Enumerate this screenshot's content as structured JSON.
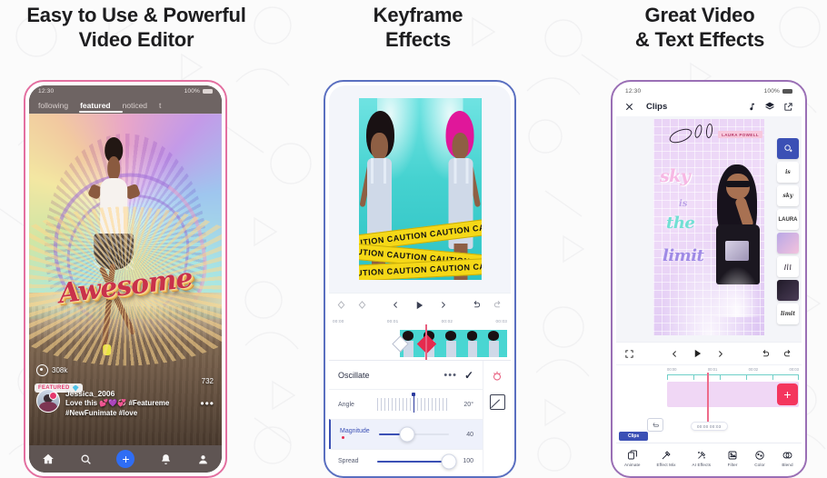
{
  "headings": {
    "left_line1": "Easy to Use & Powerful",
    "left_line2": "Video Editor",
    "mid_line1": "Keyframe",
    "mid_line2": "Effects",
    "right_line1": "Great Video",
    "right_line2": "& Text Effects"
  },
  "colors": {
    "frame_left": "#e36fa0",
    "frame_mid": "#5a6fc0",
    "frame_right": "#9a6fb5",
    "accent_blue": "#3b50b5",
    "accent_red": "#e52b4e",
    "fab_blue": "#2f6df4",
    "add_red": "#f4365e",
    "background": "#fbfbfb"
  },
  "phone1": {
    "status": {
      "time": "12:30",
      "battery": "100%"
    },
    "tabs": [
      {
        "label": "following",
        "active": false
      },
      {
        "label": "featured",
        "active": true
      },
      {
        "label": "noticed",
        "active": false
      },
      {
        "label": "t",
        "active": false
      }
    ],
    "artwork_text": "Awesome",
    "views": "308k",
    "likes": "732",
    "badge": "FEATURED",
    "username": "Jessica_2006",
    "caption_line1": "Love this 💕💜💞 #Featureme",
    "caption_line2": "#NewFunimate #love",
    "more_icon": "•••",
    "nav": [
      {
        "name": "home-icon",
        "label": "home"
      },
      {
        "name": "search-icon",
        "label": "search"
      },
      {
        "name": "create-icon",
        "label": "+"
      },
      {
        "name": "notifications-icon",
        "label": "alerts"
      },
      {
        "name": "profile-icon",
        "label": "profile"
      }
    ]
  },
  "phone2": {
    "tape_text": "CAUTION CAUTION CAUTION CAUTION CAUTION",
    "transport": {
      "prev": "‹",
      "play": "▶",
      "next": "›",
      "undo": "↩",
      "redo": "↪"
    },
    "ruler": [
      "00:00",
      "00:01",
      "00:02",
      "00:03"
    ],
    "panel": {
      "title": "Oscillate",
      "menu": "•••",
      "confirm": "✓",
      "rows": [
        {
          "label": "Angle",
          "value": "20°",
          "type": "ticks",
          "selected": false
        },
        {
          "label": "Magnitude",
          "value": "40",
          "type": "slider",
          "fill": 40,
          "selected": true
        },
        {
          "label": "Spread",
          "value": "100",
          "type": "slider",
          "fill": 100,
          "selected": false
        }
      ]
    }
  },
  "phone3": {
    "status": {
      "time": "12:30",
      "battery": "100%"
    },
    "header": {
      "close": "✕",
      "title": "Clips",
      "music_icon": "♪",
      "layers_icon": "layers",
      "export_icon": "export"
    },
    "poster": {
      "line1": "sky",
      "line2": "is",
      "line3": "the",
      "line4": "limit",
      "sticker_label": "LAURA POWELL"
    },
    "layer_rail": [
      {
        "name": "add-layer",
        "label": "✦",
        "active": true
      },
      {
        "name": "text-layer",
        "label": "is"
      },
      {
        "name": "sky-layer",
        "label": "sky"
      },
      {
        "name": "sticker-layer",
        "label": "LAURA"
      },
      {
        "name": "glitter-layer",
        "label": ""
      },
      {
        "name": "doodle-layer",
        "label": ""
      },
      {
        "name": "photo-layer",
        "label": ""
      },
      {
        "name": "limit-layer",
        "label": "limit"
      }
    ],
    "transport": {
      "fullscreen": "fullscreen",
      "prev": "‹",
      "play": "▶",
      "next": "›",
      "undo": "↩",
      "redo": "↪"
    },
    "ruler": [
      "00:00",
      "00:01",
      "00:02",
      "00:03"
    ],
    "time_pill": "00:00  00:03",
    "clip_tag": "Clips",
    "add_button": "+",
    "toolbar": [
      {
        "label": "Animate",
        "icon": "animate-icon"
      },
      {
        "label": "Effect Mix",
        "icon": "effect-mix-icon"
      },
      {
        "label": "AI Effects",
        "icon": "ai-effects-icon"
      },
      {
        "label": "Filter",
        "icon": "filter-icon"
      },
      {
        "label": "Color",
        "icon": "color-icon"
      },
      {
        "label": "Blend",
        "icon": "blend-icon"
      }
    ]
  }
}
